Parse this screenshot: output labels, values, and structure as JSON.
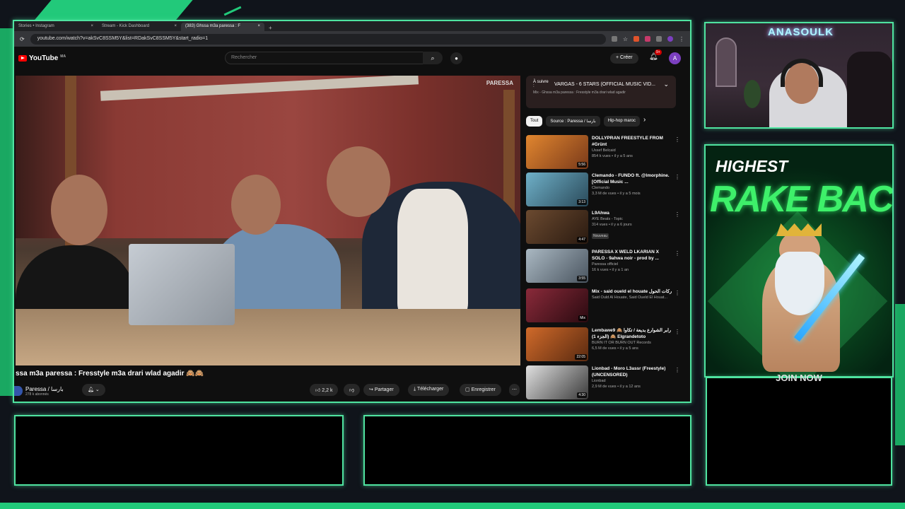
{
  "colors": {
    "accent": "#4fe3a0",
    "yt_red": "#ff0000"
  },
  "tabs": [
    {
      "label": "Stories • Instagram"
    },
    {
      "label": "Stream - Kick Dashboard"
    },
    {
      "label": "(383) Ghssa m3a paressa : F"
    }
  ],
  "url": "youtube.com/watch?v=akSvC8SSM5Y&list=RDakSvC8SSM5Y&start_radio=1",
  "yt": {
    "logo": "YouTube",
    "country": "MA",
    "search_placeholder": "Rechercher",
    "create": "+ Créer",
    "notif_count": "9+",
    "avatar_letter": "A"
  },
  "video": {
    "watermark": "PARESSA",
    "title": "ssa m3a paressa : Fresstyle m3a drari wlad agadir 🙈🙈",
    "channel": "Paressa / بارسا",
    "subscribers": "278 k abonnés",
    "likes": "2,2 k",
    "share": "Partager",
    "download": "Télécharger",
    "save": "Enregistrer"
  },
  "upnext": {
    "label": "À suivre :",
    "title": "VARGAS - 6 STARS (OFFICIAL MUSIC VID...",
    "subtitle": "Mix - Ghssa m3a paressa : Fresstyle m3a drari wlad agadir"
  },
  "chips": [
    "Tout",
    "Source : Paressa / بارسا",
    "Hip-hop maroc"
  ],
  "recommendations": [
    {
      "title": "DOLLYPRAN FREESTYLE FROM #Grünt",
      "channel": "Ussef Belcaid",
      "meta": "854 k vues • il y a 5 ans",
      "duration": "5:56",
      "thumb": "#c9762e"
    },
    {
      "title": "Clemando - FUNDO ft. @lmorphine. [Official Music ...",
      "channel": "Clemando",
      "meta": "3,3 M de vues • il y a 5 mois",
      "duration": "3:13",
      "thumb": "#4a8aa0"
    },
    {
      "title": "L9Ahwa",
      "channel": "AYE Beats - Topic",
      "meta": "314 vues • il y a 6 jours",
      "duration": "4:47",
      "thumb": "#5a3a26",
      "badge": "Nouveau"
    },
    {
      "title": "PARESSA X WELD LKARIAN X SOLO - 9ahwa noir - prod by ...",
      "channel": "Paressa officiel",
      "meta": "16 k vues • il y a 1 an",
      "duration": "3:55",
      "thumb": "#8a9aa6"
    },
    {
      "title": "Mix - said oueld el houate ركات الحول",
      "channel": "Said Ould Al Houate, Said Oueld El Houat...",
      "meta": "",
      "duration": "Mix",
      "thumb": "#6a1f2a"
    },
    {
      "title": "Lembawe9 رابر الشوارع بديعة / تكاوا 🙈 🙈 (الجزء 1) Elgrandetoto",
      "channel": "BURN IT OR BURN OUT Records",
      "meta": "6,5 M de vues • il y a 5 ans",
      "duration": "22:05",
      "thumb": "#b85a2a"
    },
    {
      "title": "Lionbad - Moro L3assr (Freestyle) (UNCENSORED)",
      "channel": "Lionbad",
      "meta": "2,9 M de vues • il y a 12 ans",
      "duration": "4:30",
      "thumb": "#bdbdbd"
    }
  ],
  "streamer": {
    "name": "ANASOULK"
  },
  "ad": {
    "line1": "HIGHEST",
    "line2": "RAKE BACK",
    "cta": "JOIN NOW"
  }
}
